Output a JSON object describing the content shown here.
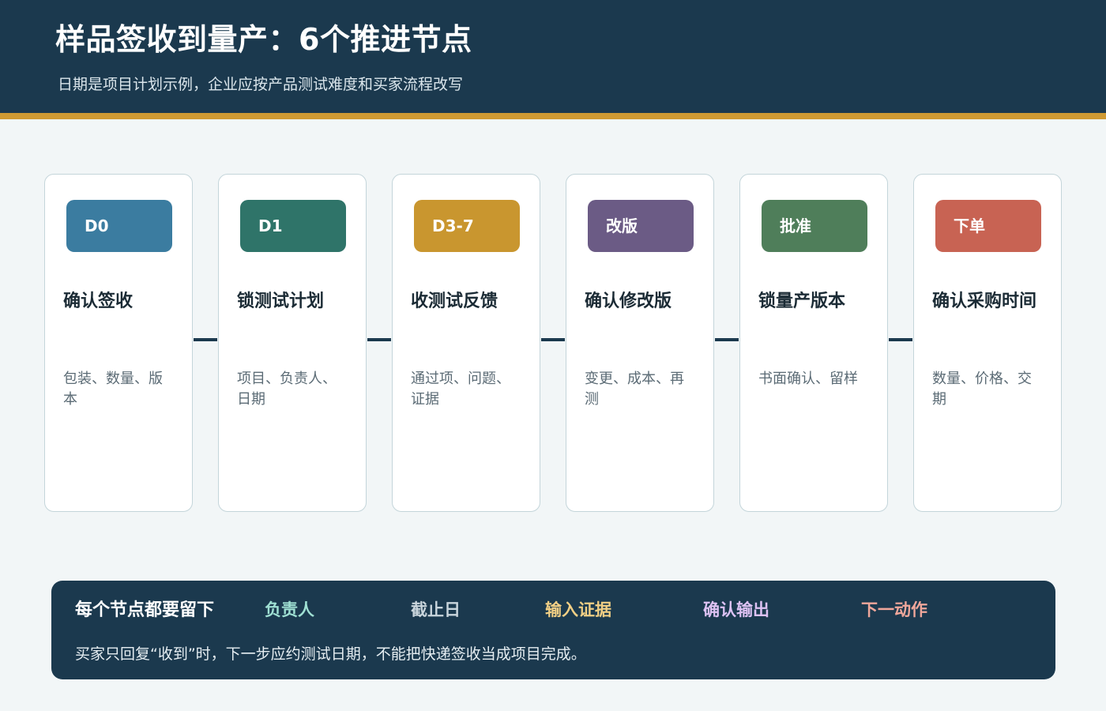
{
  "header": {
    "title": "样品签收到量产：6个推进节点",
    "subtitle": "日期是项目计划示例，企业应按产品测试难度和买家流程改写"
  },
  "steps": [
    {
      "badge": "D0",
      "title": "确认签收",
      "desc": "包装、数量、版本",
      "color": "#3b7ca0"
    },
    {
      "badge": "D1",
      "title": "锁测试计划",
      "desc": "项目、负责人、日期",
      "color": "#2f7469"
    },
    {
      "badge": "D3-7",
      "title": "收测试反馈",
      "desc": "通过项、问题、证据",
      "color": "#c9962f"
    },
    {
      "badge": "改版",
      "title": "确认修改版",
      "desc": "变更、成本、再测",
      "color": "#6b5b85"
    },
    {
      "badge": "批准",
      "title": "锁量产版本",
      "desc": "书面确认、留样",
      "color": "#4f7e5a"
    },
    {
      "badge": "下单",
      "title": "确认采购时间",
      "desc": "数量、价格、交期",
      "color": "#c86353"
    }
  ],
  "footer": {
    "label": "每个节点都要留下",
    "items": [
      {
        "text": "负责人",
        "color": "#9fe0d3"
      },
      {
        "text": "截止日",
        "color": "#c9d5dc"
      },
      {
        "text": "输入证据",
        "color": "#f1cf85"
      },
      {
        "text": "确认输出",
        "color": "#ddc2f3"
      },
      {
        "text": "下一动作",
        "color": "#f0a79b"
      }
    ],
    "note": "买家只回复“收到”时，下一步应约测试日期，不能把快递签收当成项目完成。"
  }
}
